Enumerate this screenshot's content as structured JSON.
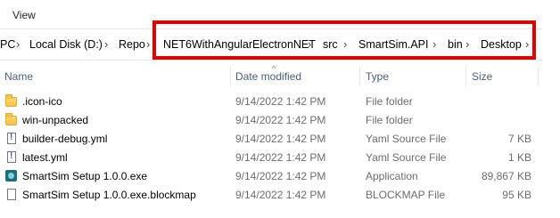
{
  "ribbon": {
    "view_tab": "View"
  },
  "addressbar": {
    "crumbs": [
      "PC",
      "Local Disk (D:)",
      "Repo",
      "NET6WithAngularElectronNET",
      "src",
      "SmartSim.API",
      "bin",
      "Desktop"
    ],
    "separator": "›"
  },
  "columns": {
    "name": "Name",
    "date": "Date modified",
    "type": "Type",
    "size": "Size"
  },
  "files": [
    {
      "name": ".icon-ico",
      "date": "9/14/2022 1:42 PM",
      "type": "File folder",
      "size": "",
      "icon": "folder-icon"
    },
    {
      "name": "win-unpacked",
      "date": "9/14/2022 1:42 PM",
      "type": "File folder",
      "size": "",
      "icon": "folder-icon"
    },
    {
      "name": "builder-debug.yml",
      "date": "9/14/2022 1:42 PM",
      "type": "Yaml Source File",
      "size": "7 KB",
      "icon": "yaml-file-icon"
    },
    {
      "name": "latest.yml",
      "date": "9/14/2022 1:42 PM",
      "type": "Yaml Source File",
      "size": "1 KB",
      "icon": "yaml-file-icon"
    },
    {
      "name": "SmartSim Setup 1.0.0.exe",
      "date": "9/14/2022 1:42 PM",
      "type": "Application",
      "size": "89,867 KB",
      "icon": "application-icon"
    },
    {
      "name": "SmartSim Setup 1.0.0.exe.blockmap",
      "date": "9/14/2022 1:42 PM",
      "type": "BLOCKMAP File",
      "size": "95 KB",
      "icon": "blank-file-icon"
    }
  ]
}
